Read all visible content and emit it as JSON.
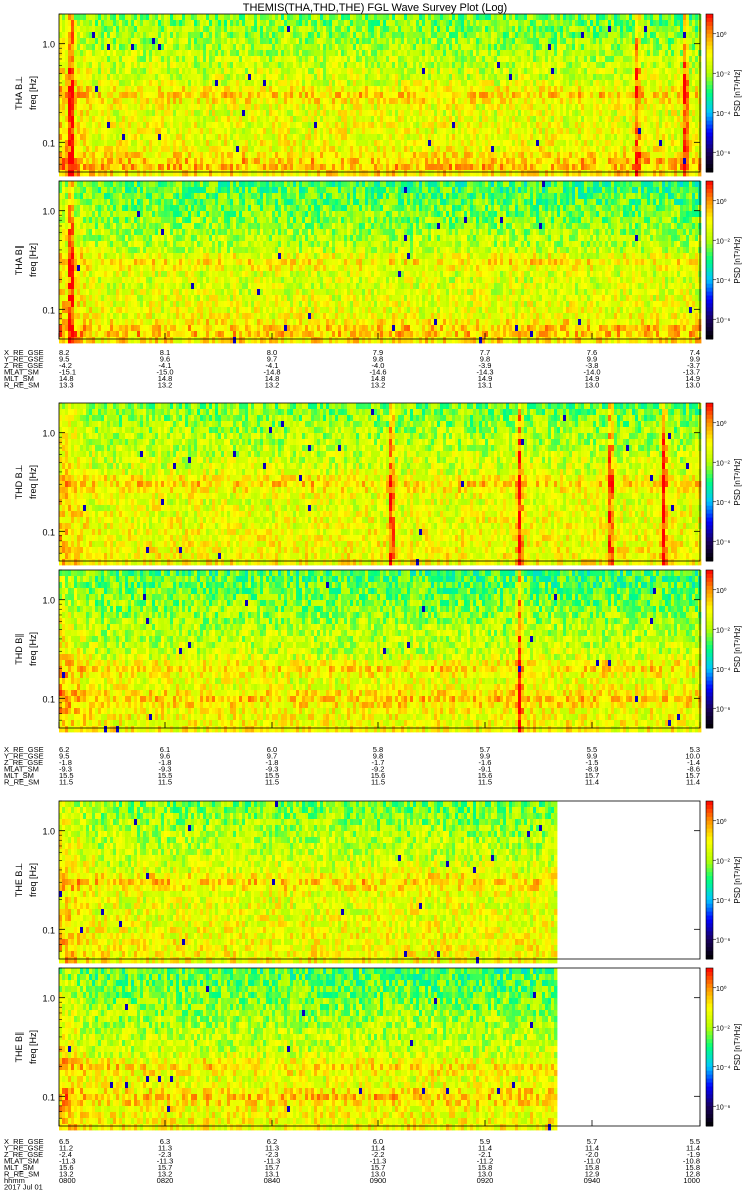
{
  "title": "THEMIS(THA,THD,THE) FGL Wave Survey Plot (Log)",
  "colorbar": {
    "label": "PSD [nT²/Hz]",
    "ticks": [
      "10⁰",
      "10⁻²",
      "10⁻⁴",
      "10⁻⁶"
    ]
  },
  "freq_ticks": [
    "1.0",
    "0.1"
  ],
  "panels": [
    {
      "id": "tha-bperp",
      "label": "THA B⊥",
      "ylabel": "freq [Hz]",
      "probe": "tha"
    },
    {
      "id": "tha-bpar",
      "label": "THA B∥",
      "ylabel": "freq [Hz]",
      "probe": "tha"
    },
    {
      "id": "thd-bperp",
      "label": "THD B⊥",
      "ylabel": "freq [Hz]",
      "probe": "thd"
    },
    {
      "id": "thd-bpar",
      "label": "THD B∥",
      "ylabel": "freq [Hz]",
      "probe": "thd"
    },
    {
      "id": "the-bperp",
      "label": "THE B⊥",
      "ylabel": "freq [Hz]",
      "probe": "the"
    },
    {
      "id": "the-bpar",
      "label": "THE B∥",
      "ylabel": "freq [Hz]",
      "probe": "the"
    }
  ],
  "ephem_blocks": [
    {
      "rows": [
        {
          "name": "X_RE_GSE",
          "values": [
            "8.2",
            "8.1",
            "8.0",
            "7.9",
            "7.7",
            "7.6",
            "7.4"
          ]
        },
        {
          "name": "Y_RE_GSE",
          "values": [
            "9.5",
            "9.6",
            "9.7",
            "9.8",
            "9.8",
            "9.9",
            "9.9"
          ]
        },
        {
          "name": "Z_RE_GSE",
          "values": [
            "-4.2",
            "-4.1",
            "-4.1",
            "-4.0",
            "-3.9",
            "-3.8",
            "-3.7"
          ]
        },
        {
          "name": "MLAT_SM",
          "values": [
            "-15.1",
            "-15.0",
            "-14.8",
            "-14.6",
            "-14.3",
            "-14.0",
            "-13.7"
          ]
        },
        {
          "name": "MLT_SM",
          "values": [
            "14.8",
            "14.8",
            "14.8",
            "14.8",
            "14.9",
            "14.9",
            "14.9"
          ]
        },
        {
          "name": "R_RE_SM",
          "values": [
            "13.3",
            "13.2",
            "13.2",
            "13.2",
            "13.1",
            "13.0",
            "13.0"
          ]
        }
      ]
    },
    {
      "rows": [
        {
          "name": "X_RE_GSE",
          "values": [
            "6.2",
            "6.1",
            "6.0",
            "5.8",
            "5.7",
            "5.5",
            "5.3"
          ]
        },
        {
          "name": "Y_RE_GSE",
          "values": [
            "9.5",
            "9.6",
            "9.7",
            "9.8",
            "9.9",
            "9.9",
            "10.0"
          ]
        },
        {
          "name": "Z_RE_GSE",
          "values": [
            "-1.8",
            "-1.8",
            "-1.8",
            "-1.7",
            "-1.6",
            "-1.5",
            "-1.4"
          ]
        },
        {
          "name": "MLAT_SM",
          "values": [
            "-9.3",
            "-9.3",
            "-9.3",
            "-9.2",
            "-9.1",
            "-8.9",
            "-8.6"
          ]
        },
        {
          "name": "MLT_SM",
          "values": [
            "15.5",
            "15.5",
            "15.5",
            "15.6",
            "15.6",
            "15.7",
            "15.7"
          ]
        },
        {
          "name": "R_RE_SM",
          "values": [
            "11.5",
            "11.5",
            "11.5",
            "11.5",
            "11.5",
            "11.4",
            "11.4"
          ]
        }
      ]
    },
    {
      "rows": [
        {
          "name": "X_RE_GSE",
          "values": [
            "6.5",
            "6.3",
            "6.2",
            "6.0",
            "5.9",
            "5.7",
            "5.5"
          ]
        },
        {
          "name": "Y_RE_GSE",
          "values": [
            "11.2",
            "11.3",
            "11.3",
            "11.4",
            "11.4",
            "11.4",
            "11.4"
          ]
        },
        {
          "name": "Z_RE_GSE",
          "values": [
            "-2.4",
            "-2.3",
            "-2.3",
            "-2.2",
            "-2.1",
            "-2.0",
            "-1.9"
          ]
        },
        {
          "name": "MLAT_SM",
          "values": [
            "-11.3",
            "-11.3",
            "-11.3",
            "-11.3",
            "-11.2",
            "-11.0",
            "-10.8"
          ]
        },
        {
          "name": "MLT_SM",
          "values": [
            "15.6",
            "15.7",
            "15.7",
            "15.7",
            "15.8",
            "15.8",
            "15.8"
          ]
        },
        {
          "name": "R_RE_SM",
          "values": [
            "13.2",
            "13.2",
            "13.1",
            "13.0",
            "13.0",
            "12.9",
            "12.8"
          ]
        },
        {
          "name": "hhmm",
          "values": [
            "0800",
            "0820",
            "0840",
            "0900",
            "0920",
            "0940",
            "1000"
          ]
        },
        {
          "name": "2017 Jul 01",
          "values": []
        }
      ]
    }
  ],
  "chart_data": {
    "type": "heatmap",
    "title": "THEMIS(THA,THD,THE) FGL Wave Survey Plot (Log)",
    "x": [
      "0800",
      "0820",
      "0840",
      "0900",
      "0920",
      "0940",
      "1000"
    ],
    "xlabel": "hhmm",
    "date": "2017 Jul 01",
    "ylabel": "freq [Hz]",
    "yscale": "log",
    "ylim": [
      0.05,
      2.0
    ],
    "ytick_labels": [
      "1.0",
      "0.1"
    ],
    "zlabel": "PSD [nT²/Hz]",
    "zscale": "log",
    "zlim": [
      1e-07,
      10.0
    ],
    "ztick_labels": [
      "10⁰",
      "10⁻²",
      "10⁻⁴",
      "10⁻⁶"
    ],
    "colormap": [
      "#000000",
      "#1a0060",
      "#0000ff",
      "#00c8ff",
      "#00ff80",
      "#b8ff00",
      "#ffff00",
      "#ff9000",
      "#ff0000"
    ],
    "series": [
      {
        "name": "THA B⊥",
        "time_range": [
          "0800",
          "1000"
        ],
        "peak_times": [
          "0802",
          "0948",
          "0957"
        ],
        "band_freqs_hz": [
          0.06,
          0.3
        ]
      },
      {
        "name": "THA B∥",
        "time_range": [
          "0800",
          "1000"
        ],
        "peak_times": [
          "0802"
        ],
        "band_freqs_hz": [
          0.06,
          0.3
        ]
      },
      {
        "name": "THD B⊥",
        "time_range": [
          "0800",
          "1000"
        ],
        "peak_times": [
          "0902",
          "0926",
          "0943",
          "0953"
        ],
        "band_freqs_hz": [
          0.3
        ]
      },
      {
        "name": "THD B∥",
        "time_range": [
          "0800",
          "1000"
        ],
        "peak_times": [
          "0926"
        ],
        "band_freqs_hz": [
          0.1,
          0.2
        ]
      },
      {
        "name": "THE B⊥",
        "time_range": [
          "0800",
          "0933"
        ],
        "peak_times": [],
        "band_freqs_hz": [
          0.3
        ]
      },
      {
        "name": "THE B∥",
        "time_range": [
          "0800",
          "0933"
        ],
        "peak_times": [],
        "band_freqs_hz": [
          0.1,
          0.2
        ]
      }
    ]
  }
}
